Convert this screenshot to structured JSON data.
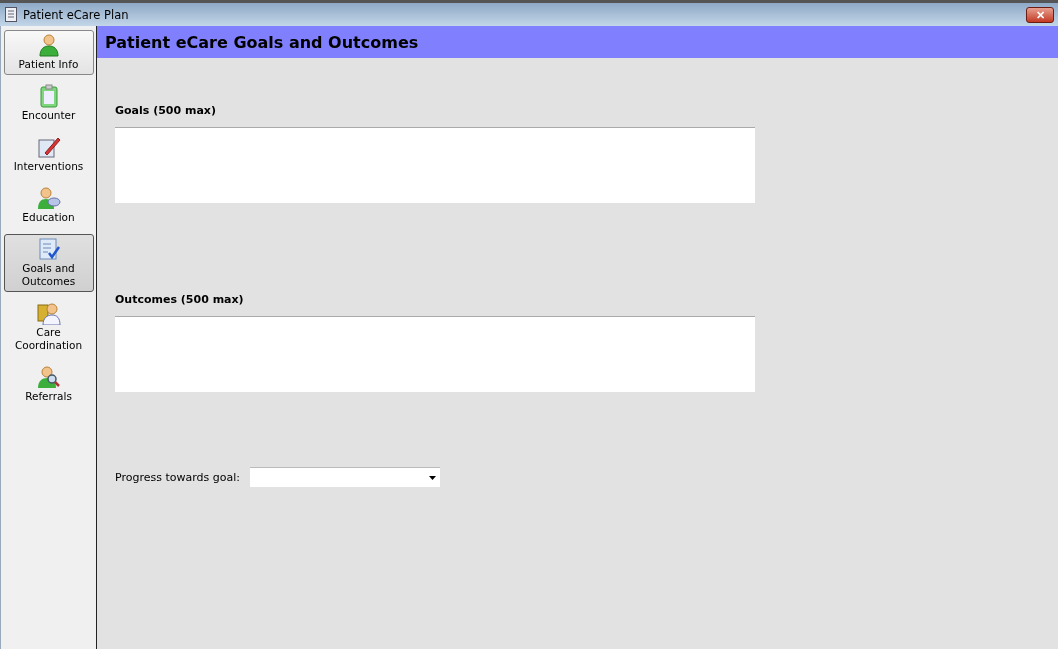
{
  "window": {
    "title": "Patient eCare Plan",
    "close_label": "✕"
  },
  "sidebar": {
    "items": [
      {
        "label": "Patient Info",
        "selected": false,
        "hovered": true
      },
      {
        "label": "Encounter",
        "selected": false,
        "hovered": false
      },
      {
        "label": "Interventions",
        "selected": false,
        "hovered": false
      },
      {
        "label": "Education",
        "selected": false,
        "hovered": false
      },
      {
        "label": "Goals and Outcomes",
        "selected": true,
        "hovered": false
      },
      {
        "label": "Care Coordination",
        "selected": false,
        "hovered": false
      },
      {
        "label": "Referrals",
        "selected": false,
        "hovered": false
      }
    ]
  },
  "header": {
    "title": "Patient eCare Goals and Outcomes"
  },
  "fields": [
    {
      "label": "Goals (500 max)"
    },
    {
      "label": "Outcomes (500 max)"
    }
  ],
  "progress": {
    "label": "Progress towards goal:"
  }
}
